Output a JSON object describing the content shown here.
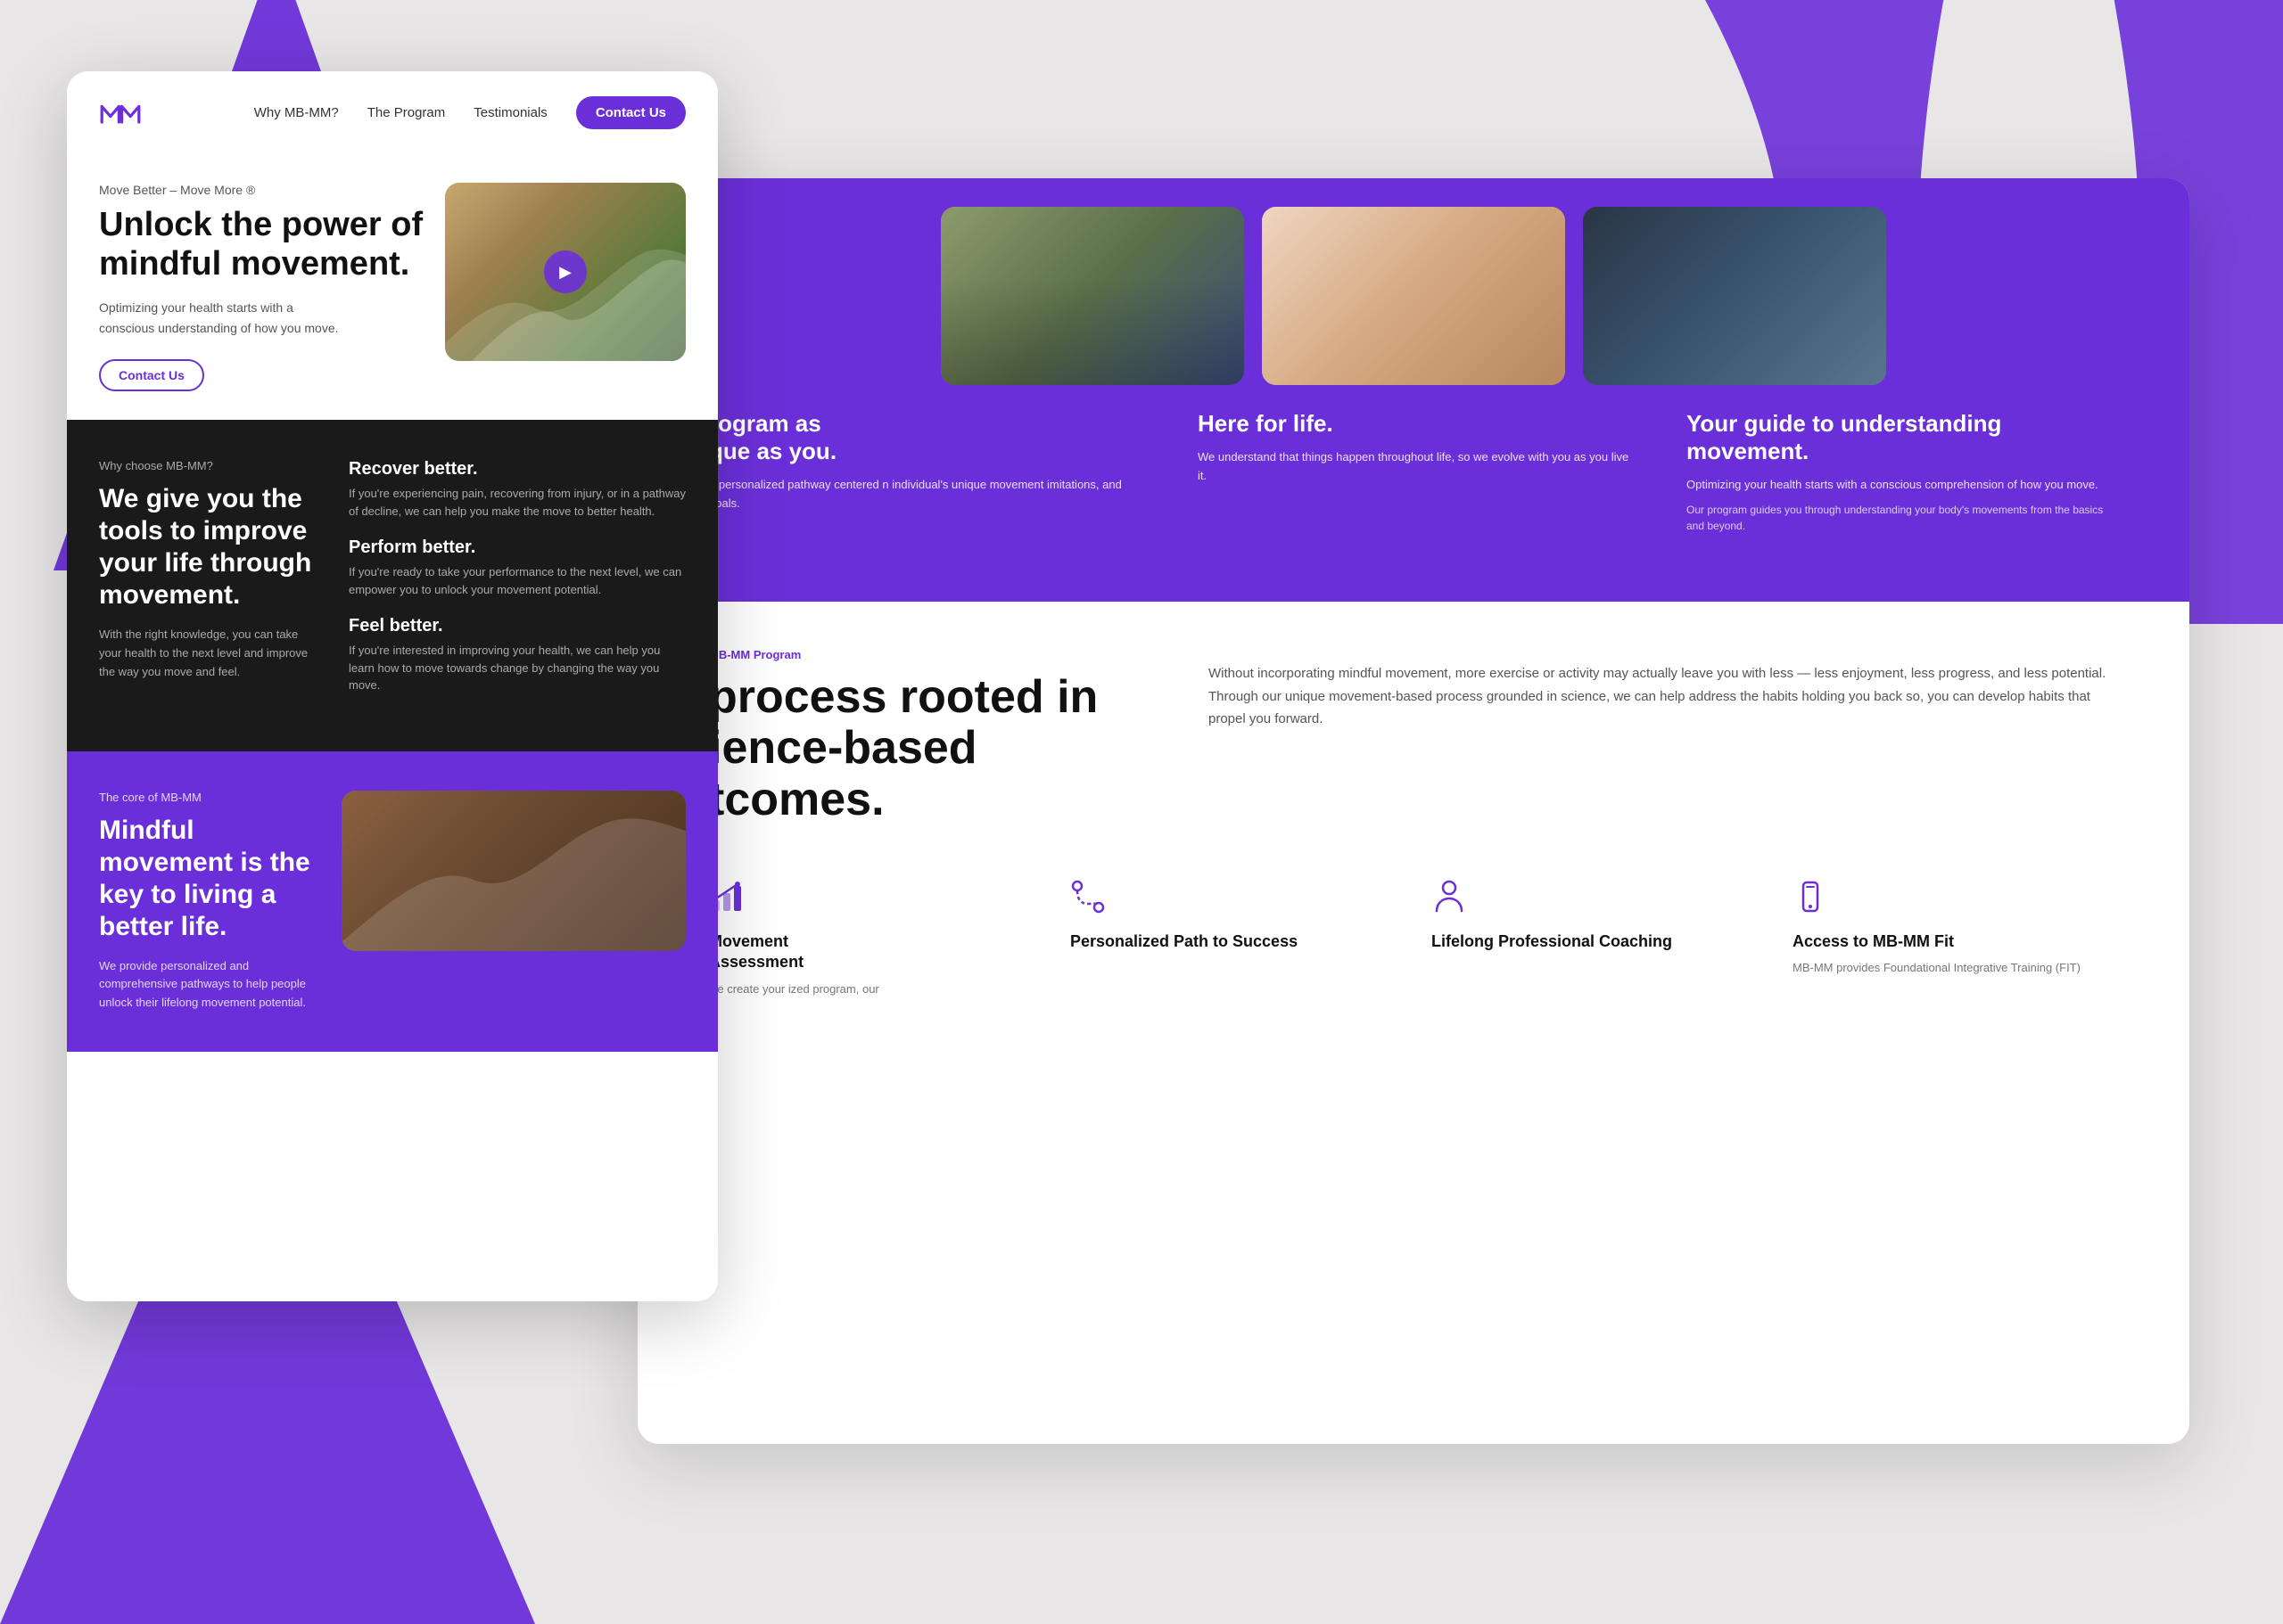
{
  "bg": {
    "color": "#e0dede"
  },
  "front_card": {
    "nav": {
      "logo_text": "∧∧",
      "links": [
        "Why MB-MM?",
        "The Program",
        "Testimonials"
      ],
      "contact_btn": "Contact Us"
    },
    "hero": {
      "eyebrow": "Move Better – Move More ®",
      "title": "Unlock the power of mindful movement.",
      "subtitle": "Optimizing your health starts with a conscious understanding of how you move.",
      "cta_btn": "Contact Us"
    },
    "dark_section": {
      "eyebrow": "Why choose MB-MM?",
      "title": "We give you the tools to improve your life through movement.",
      "subtitle": "With the right knowledge, you can take your health to the next level and improve the way you move and feel.",
      "features": [
        {
          "title": "Recover better.",
          "text": "If you're experiencing pain, recovering from injury, or in a pathway of decline, we can help you make the move to better health."
        },
        {
          "title": "Perform better.",
          "text": "If you're ready to take your performance to the next level, we can empower you to unlock your movement potential."
        },
        {
          "title": "Feel better.",
          "text": "If you're interested in improving your health, we can help you learn how to move towards change by changing the way you move."
        }
      ]
    },
    "purple_section": {
      "eyebrow": "The core of MB-MM",
      "title": "Mindful movement is the key to living a better life.",
      "subtitle": "We provide personalized and comprehensive pathways to help people unlock their lifelong movement potential."
    }
  },
  "back_card": {
    "image_cards": [
      {
        "title_partial": "rogram as",
        "title_line2": "que as you.",
        "text": "a personalized pathway centered n individual's unique movement imitations, and goals."
      },
      {
        "title": "Here for life.",
        "text": "We understand that things happen throughout life, so we evolve with you as you live it."
      },
      {
        "title": "Your guide to understanding movement.",
        "text": "Optimizing your health starts with a conscious comprehension of how you move.",
        "text2": "Our program guides you through understanding your body's movements from the basics and beyond."
      }
    ],
    "program_section": {
      "label": "MB-MM Program",
      "title_partial": "process rooted in",
      "title_line2": "ience-based",
      "title_line3": "tcomes.",
      "body_text": "Without incorporating mindful movement, more exercise or activity may actually leave you with less — less enjoyment, less progress, and less potential. Through our unique movement-based process grounded in science, we can help address the habits holding you back so, you can develop habits that propel you forward."
    },
    "features": [
      {
        "icon": "chart-icon",
        "title": "Movement\nssessment",
        "text": "we create your ized program, our"
      },
      {
        "icon": "path-icon",
        "title": "Personalized Path to Success",
        "text": ""
      },
      {
        "icon": "person-icon",
        "title": "Lifelong Professional Coaching",
        "text": ""
      },
      {
        "icon": "phone-icon",
        "title": "Access to MB-MM Fit",
        "text": "MB-MM provides Foundational Integrative Training (FIT)"
      }
    ]
  }
}
